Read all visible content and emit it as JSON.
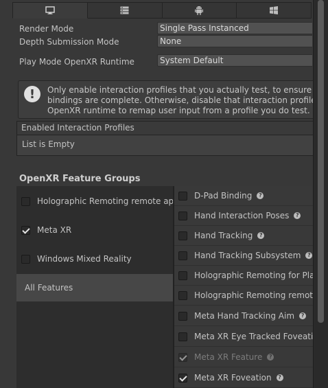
{
  "tabs": [
    {
      "icon": "monitor-icon",
      "active": true
    },
    {
      "icon": "server-icon",
      "active": false
    },
    {
      "icon": "android-icon",
      "active": false
    },
    {
      "icon": "windows-icon",
      "active": false
    }
  ],
  "settings": {
    "render_mode": {
      "label": "Render Mode",
      "value": "Single Pass Instanced"
    },
    "depth_submission_mode": {
      "label": "Depth Submission Mode",
      "value": "None"
    },
    "play_mode_runtime": {
      "label": "Play Mode OpenXR Runtime",
      "value": "System Default"
    }
  },
  "help": {
    "icon": "info-icon",
    "line1": "Only enable interaction profiles that you actually test, to ensure their",
    "line2": "bindings are complete. Otherwise, disable that interaction profile, to a",
    "line3": "OpenXR runtime to remap user input from a profile you do test."
  },
  "interaction_profiles": {
    "header": "Enabled Interaction Profiles",
    "empty_text": "List is Empty"
  },
  "feature_groups": {
    "title": "OpenXR Feature Groups",
    "groups": [
      {
        "label": "Holographic Remoting remote app",
        "checked": false
      },
      {
        "label": "Meta XR",
        "checked": true
      },
      {
        "label": "Windows Mixed Reality",
        "checked": false
      }
    ],
    "all_features_label": "All Features"
  },
  "features": [
    {
      "label": "D-Pad Binding",
      "checked": false,
      "help": true,
      "disabled": false
    },
    {
      "label": "Hand Interaction Poses",
      "checked": false,
      "help": true,
      "disabled": false
    },
    {
      "label": "Hand Tracking",
      "checked": false,
      "help": true,
      "disabled": false
    },
    {
      "label": "Hand Tracking Subsystem",
      "checked": false,
      "help": true,
      "disabled": false
    },
    {
      "label": "Holographic Remoting for Play",
      "checked": false,
      "help": false,
      "disabled": false
    },
    {
      "label": "Holographic Remoting remote a",
      "checked": false,
      "help": false,
      "disabled": false
    },
    {
      "label": "Meta Hand Tracking Aim",
      "checked": false,
      "help": true,
      "disabled": false
    },
    {
      "label": "Meta XR Eye Tracked Foveatio",
      "checked": false,
      "help": false,
      "disabled": false
    },
    {
      "label": "Meta XR Feature",
      "checked": true,
      "help": true,
      "disabled": true
    },
    {
      "label": "Meta XR Foveation",
      "checked": true,
      "help": true,
      "disabled": false
    }
  ],
  "help_glyph": "?"
}
